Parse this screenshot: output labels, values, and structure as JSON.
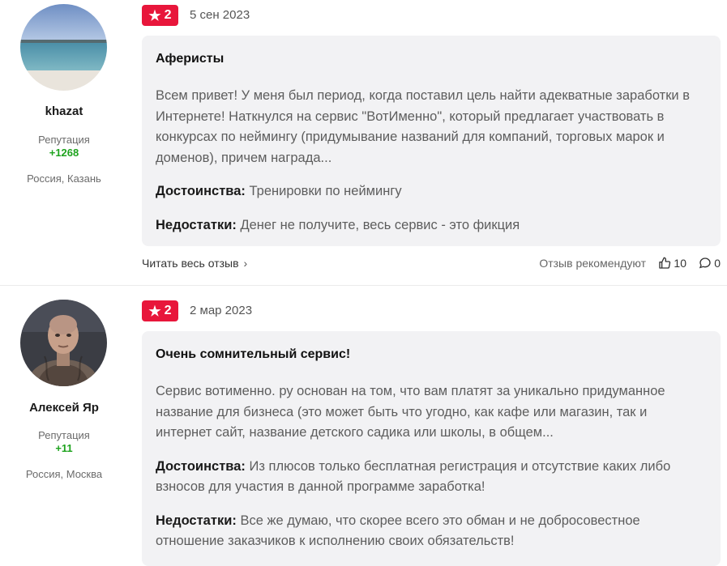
{
  "reviews": [
    {
      "author": {
        "name": "khazat",
        "reputation_label": "Репутация",
        "reputation": "+1268",
        "location": "Россия, Казань"
      },
      "rating": "2",
      "date": "5 сен 2023",
      "title": "Аферисты",
      "body": "Всем привет! У меня был период, когда поставил цель найти адекватные заработки в Интернете! Наткнулся на сервис \"ВотИменно\", который предлагает участвовать в конкурсах по неймингу (придумывание названий для компаний, торговых марок и доменов), причем награда...",
      "pros_label": "Достоинства:",
      "pros": "Тренировки по неймингу",
      "cons_label": "Недостатки:",
      "cons": "Денег не получите, весь сервис - это фикция",
      "read_more": "Читать весь отзыв",
      "recommend_label": "Отзыв рекомендуют",
      "likes": "10",
      "comments": "0"
    },
    {
      "author": {
        "name": "Алексей Яр",
        "reputation_label": "Репутация",
        "reputation": "+11",
        "location": "Россия, Москва"
      },
      "rating": "2",
      "date": "2 мар 2023",
      "title": "Очень сомнительный сервис!",
      "body": "Сервис вотименно. ру основан на том, что вам платят за уникально придуманное название для бизнеса (это может быть что угодно, как кафе или магазин, так и интернет сайт, название детского садика или школы, в общем...",
      "pros_label": "Достоинства:",
      "pros": "Из плюсов только бесплатная регистрация и отсутствие каких либо взносов для участия в данной программе заработка!",
      "cons_label": "Недостатки:",
      "cons": "Все же думаю, что скорее всего это обман и не добросовестное отношение заказчиков к исполнению своих обязательств!"
    }
  ],
  "colors": {
    "badge": "#e8163b",
    "reputation": "#1ea31e",
    "card_bg": "#f2f2f4"
  },
  "icons": {
    "rating": "star-icon",
    "read_more": "chevron-right-icon",
    "likes": "thumbs-up-icon",
    "comments": "comment-icon"
  }
}
